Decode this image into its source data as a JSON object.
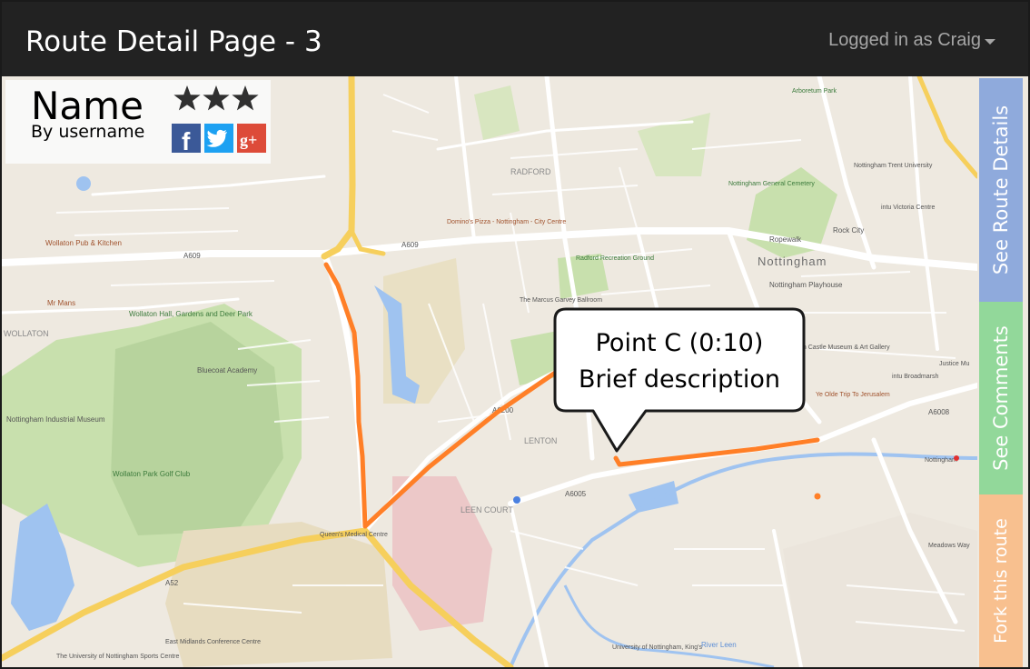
{
  "header": {
    "title": "Route Detail Page - 3",
    "user_menu_label": "Logged in as Craig"
  },
  "route_info": {
    "name": "Name",
    "author": "By username",
    "rating": 3,
    "rating_max": 3
  },
  "share_buttons": [
    {
      "icon": "facebook-icon",
      "color": "#3b5998",
      "glyph": "f"
    },
    {
      "icon": "twitter-icon",
      "color": "#1da1f2"
    },
    {
      "icon": "google-plus-icon",
      "color": "#dd4b39",
      "glyph": "g+"
    }
  ],
  "callout": {
    "title": "Point C (0:10)",
    "description": "Brief description"
  },
  "side_tabs": {
    "details": "See Route Details",
    "comments": "See Comments",
    "fork": "Fork this route"
  },
  "map": {
    "route_color": "#ff7f27",
    "water_color": "#9fc3f0",
    "park_color": "#c9dfb0",
    "labels": {
      "nottingham": "Nottingham",
      "radford": "RADFORD",
      "lenton": "LENTON",
      "leen_court": "LEEN COURT",
      "wollaton": "WOLLATON",
      "wollaton_hall": "Wollaton Hall, Gardens and Deer Park",
      "wollaton_park_golf": "Wollaton Park Golf Club",
      "industrial_museum": "Nottingham Industrial Museum",
      "bluecoat": "Bluecoat Academy",
      "queens_medical": "Queen's Medical Centre",
      "dominos": "Domino's Pizza - Nottingham - City Centre",
      "radford_ground": "Radford Recreation Ground",
      "marcus_garvey": "The Marcus Garvey Ballroom",
      "ropewalk": "Ropewalk",
      "rock_city": "Rock City",
      "playhouse": "Nottingham Playhouse",
      "castle": "Nottingham Castle Museum & Art Gallery",
      "trip": "Ye Olde Trip To Jerusalem",
      "broadmarsh": "intu Broadmarsh",
      "arboretum": "Arboretum Park",
      "general_cemetery": "Nottingham General Cemetery",
      "trent_university": "Nottingham Trent University",
      "victoria_centre": "intu Victoria Centre",
      "east_midlands": "East Midlands Conference Centre",
      "sports_centre": "The University of Nottingham Sports Centre",
      "kings": "University of Nottingham, King's",
      "river_leen": "River Leen",
      "a609": "A609",
      "a6200": "A6200",
      "a52": "A52",
      "a6005": "A6005",
      "a6008": "A6008",
      "wollaton_pub": "Wollaton Pub & Kitchen",
      "mr_mans": "Mr Mans",
      "justice": "Justice Mu",
      "nottingham_station": "Nottingham",
      "meadows_way": "Meadows Way"
    }
  }
}
